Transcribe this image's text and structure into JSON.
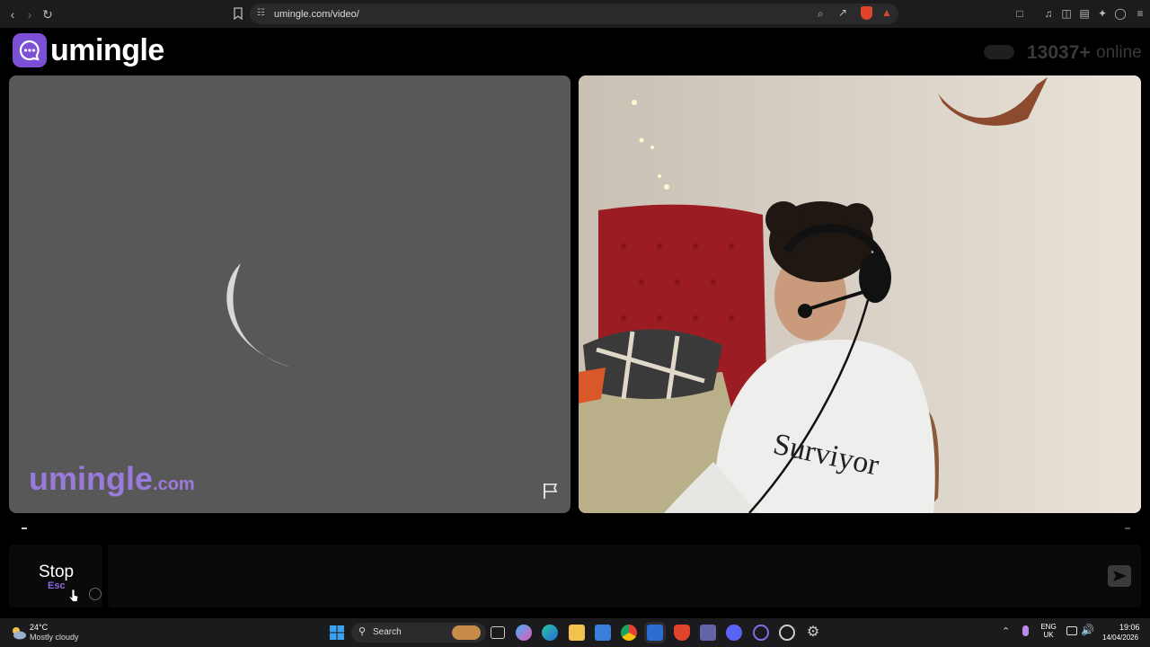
{
  "browser": {
    "url": "umingle.com/video/"
  },
  "site": {
    "logo_text": "umingle",
    "online_count": "13037+",
    "online_label": "online",
    "watermark_main": "umingle",
    "watermark_sub": ".com"
  },
  "controls": {
    "stop_label": "Stop",
    "stop_key": "Esc"
  },
  "taskbar": {
    "weather_temp": "24°C",
    "weather_desc": "Mostly cloudy",
    "search_label": "Search",
    "lang_top": "ENG",
    "lang_bottom": "UK",
    "time": "19:06",
    "date": "14/04/2026"
  },
  "colors": {
    "brand_purple": "#7b4fd6",
    "watermark_purple": "#9a7bdc",
    "panel_gray": "#585858"
  }
}
